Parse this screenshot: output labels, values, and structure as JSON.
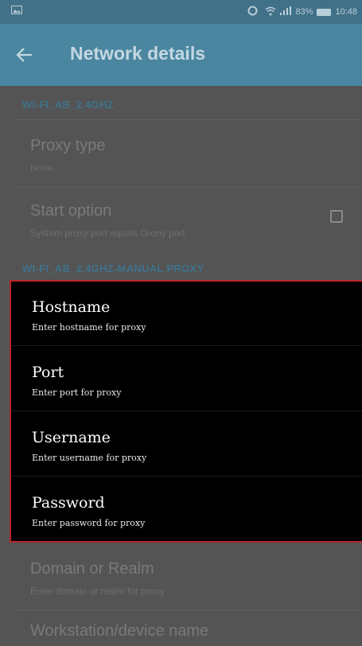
{
  "status": {
    "battery": "83%",
    "time": "10:48",
    "icons": [
      "image-icon",
      "sync-icon",
      "wifi-icon",
      "signal-icon",
      "battery-icon"
    ]
  },
  "appbar": {
    "title": "Network details",
    "back_icon": "back-arrow-icon"
  },
  "sections": {
    "wifi": "WI-FI_AB_2.4GHZ",
    "manual_proxy": "WI-FI_AB_2.4GHZ-MANUAL PROXY"
  },
  "proxy_type": {
    "title": "Proxy type",
    "summary": "None"
  },
  "start_option": {
    "title": "Start option",
    "summary": "System proxy port equals Drony port",
    "checked": false
  },
  "proxy_fields": [
    {
      "title": "Hostname",
      "summary": "Enter hostname for proxy"
    },
    {
      "title": "Port",
      "summary": "Enter port for proxy"
    },
    {
      "title": "Username",
      "summary": "Enter username for proxy"
    },
    {
      "title": "Password",
      "summary": "Enter password for proxy"
    }
  ],
  "domain": {
    "title": "Domain or Realm",
    "summary": "Enter domain or realm for proxy"
  },
  "workstation": {
    "title": "Workstation/device name"
  },
  "colors": {
    "appbar": "#4a86a0",
    "statusbar": "#417188",
    "accent": "#3f728a",
    "highlight_border": "#b8242a",
    "background": "#545454"
  }
}
